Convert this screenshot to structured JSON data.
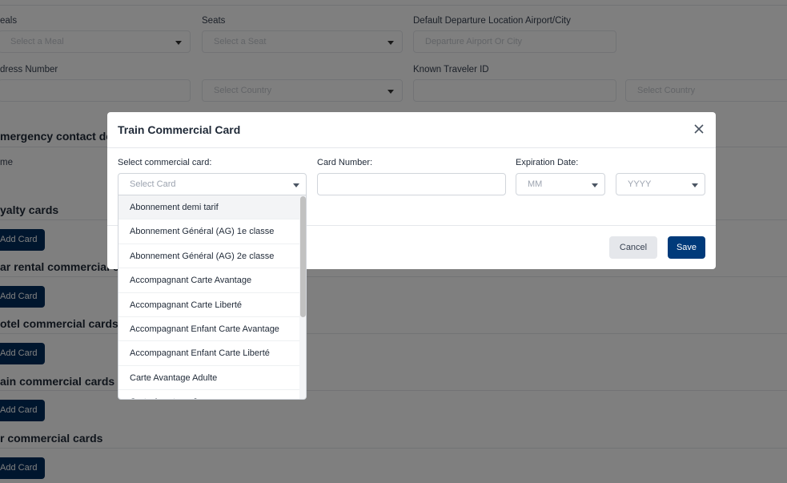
{
  "background": {
    "meals_label": "eals",
    "meals_placeholder": "Select a Meal",
    "seats_label": "Seats",
    "seats_placeholder": "Select a Seat",
    "departure_label": "Default Departure Location Airport/City",
    "departure_placeholder": "Departure Airport Or City",
    "address_label": "dress Number",
    "country_placeholder": "Select Country",
    "known_traveler_label": "Known Traveler ID",
    "country2_placeholder": "Select Country",
    "emergency_heading": "mergency contact deta",
    "name_label": "me",
    "loyalty_heading": "yalty cards",
    "car_heading": "ar rental commercial c",
    "hotel_heading": "otel commercial cards",
    "train_heading": "ain commercial cards",
    "air_heading": "r commercial cards",
    "add_card_label": "Add Card"
  },
  "modal": {
    "title": "Train Commercial Card",
    "select_card_label": "Select commercial card:",
    "select_card_placeholder": "Select Card",
    "card_number_label": "Card Number:",
    "expiration_label": "Expiration Date:",
    "month_placeholder": "MM",
    "year_placeholder": "YYYY",
    "cancel_label": "Cancel",
    "save_label": "Save"
  },
  "dropdown": {
    "options": [
      "Abonnement demi tarif",
      "Abonnement Général (AG) 1e classe",
      "Abonnement Général (AG) 2e classe",
      "Accompagnant Carte Avantage",
      "Accompagnant Carte Liberté",
      "Accompagnant Enfant Carte Avantage",
      "Accompagnant Enfant Carte Liberté",
      "Carte Avantage Adulte",
      "Carte Avantage Jeune"
    ],
    "highlighted_index": 0
  },
  "colors": {
    "primary": "#003a7a",
    "overlay": "rgba(0,0,0,0.5)"
  }
}
